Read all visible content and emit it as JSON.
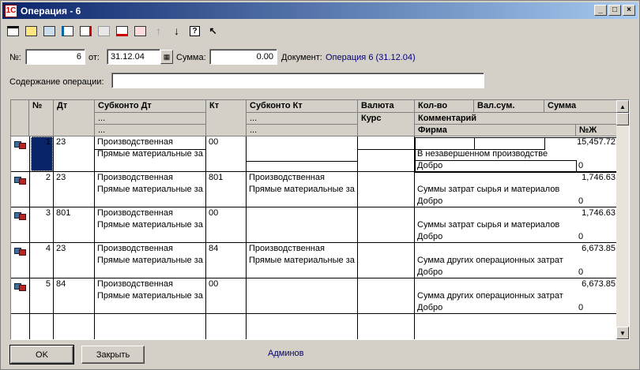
{
  "window": {
    "title": "Операция - 6",
    "app_icon": "1C",
    "min": "_",
    "max": "□",
    "close": "×"
  },
  "toolbar": {
    "icons": [
      "new-row-icon",
      "copy-row-icon",
      "edit-row-icon",
      "add-row-icon",
      "delete-row-icon",
      "disabled-row-icon",
      "cut-row-icon",
      "insert-row-icon",
      "move-up-icon",
      "move-down-icon",
      "help-icon",
      "pointer-help-icon"
    ]
  },
  "form": {
    "num_label": "№:",
    "num_value": "6",
    "from_label": "от:",
    "date_value": "31.12.04",
    "sum_label": "Сумма:",
    "sum_value": "0.00",
    "doc_label": "Документ:",
    "doc_link": "Операция 6 (31.12.04)",
    "content_label": "Содержание операции:",
    "content_value": ""
  },
  "grid": {
    "headers": {
      "num": "№",
      "dt": "Дт",
      "sub_dt": "Субконто Дт",
      "kt": "Кт",
      "sub_kt": "Субконто Кт",
      "valuta": "Валюта",
      "kurs": "Курс",
      "kolvo": "Кол-во",
      "valsum": "Вал.сум.",
      "summa": "Сумма",
      "comment": "Комментарий",
      "firma": "Фирма",
      "nzh": "№Ж",
      "dots": "..."
    },
    "rows": [
      {
        "n": "1",
        "dt": "23",
        "sub_dt1": "Производственная",
        "sub_dt2": "Прямые материальные за",
        "kt": "00",
        "sub_kt1": "",
        "sub_kt2": "",
        "summa": "15,457.72",
        "comment": "В незавершенном производстве",
        "firma": "Добро",
        "nzh": "0"
      },
      {
        "n": "2",
        "dt": "23",
        "sub_dt1": "Производственная",
        "sub_dt2": "Прямые материальные за",
        "kt": "801",
        "sub_kt1": "Производственная",
        "sub_kt2": "Прямые материальные за",
        "summa": "1,746.63",
        "comment": "Суммы затрат сырья и материалов",
        "firma": "Добро",
        "nzh": "0"
      },
      {
        "n": "3",
        "dt": "801",
        "sub_dt1": "Производственная",
        "sub_dt2": "Прямые материальные за",
        "kt": "00",
        "sub_kt1": "",
        "sub_kt2": "",
        "summa": "1,746.63",
        "comment": "Суммы затрат сырья и материалов",
        "firma": "Добро",
        "nzh": "0"
      },
      {
        "n": "4",
        "dt": "23",
        "sub_dt1": "Производственная",
        "sub_dt2": "Прямые материальные за",
        "kt": "84",
        "sub_kt1": "Производственная",
        "sub_kt2": "Прямые материальные за",
        "summa": "6,673.85",
        "comment": "Сумма других операционных затрат",
        "firma": "Добро",
        "nzh": "0"
      },
      {
        "n": "5",
        "dt": "84",
        "sub_dt1": "Производственная",
        "sub_dt2": "Прямые материальные за",
        "kt": "00",
        "sub_kt1": "",
        "sub_kt2": "",
        "summa": "6,673.85",
        "comment": "Сумма других операционных затрат",
        "firma": "Добро",
        "nzh": "0"
      }
    ]
  },
  "footer": {
    "ok": "OK",
    "close": "Закрыть",
    "user": "Админов"
  }
}
